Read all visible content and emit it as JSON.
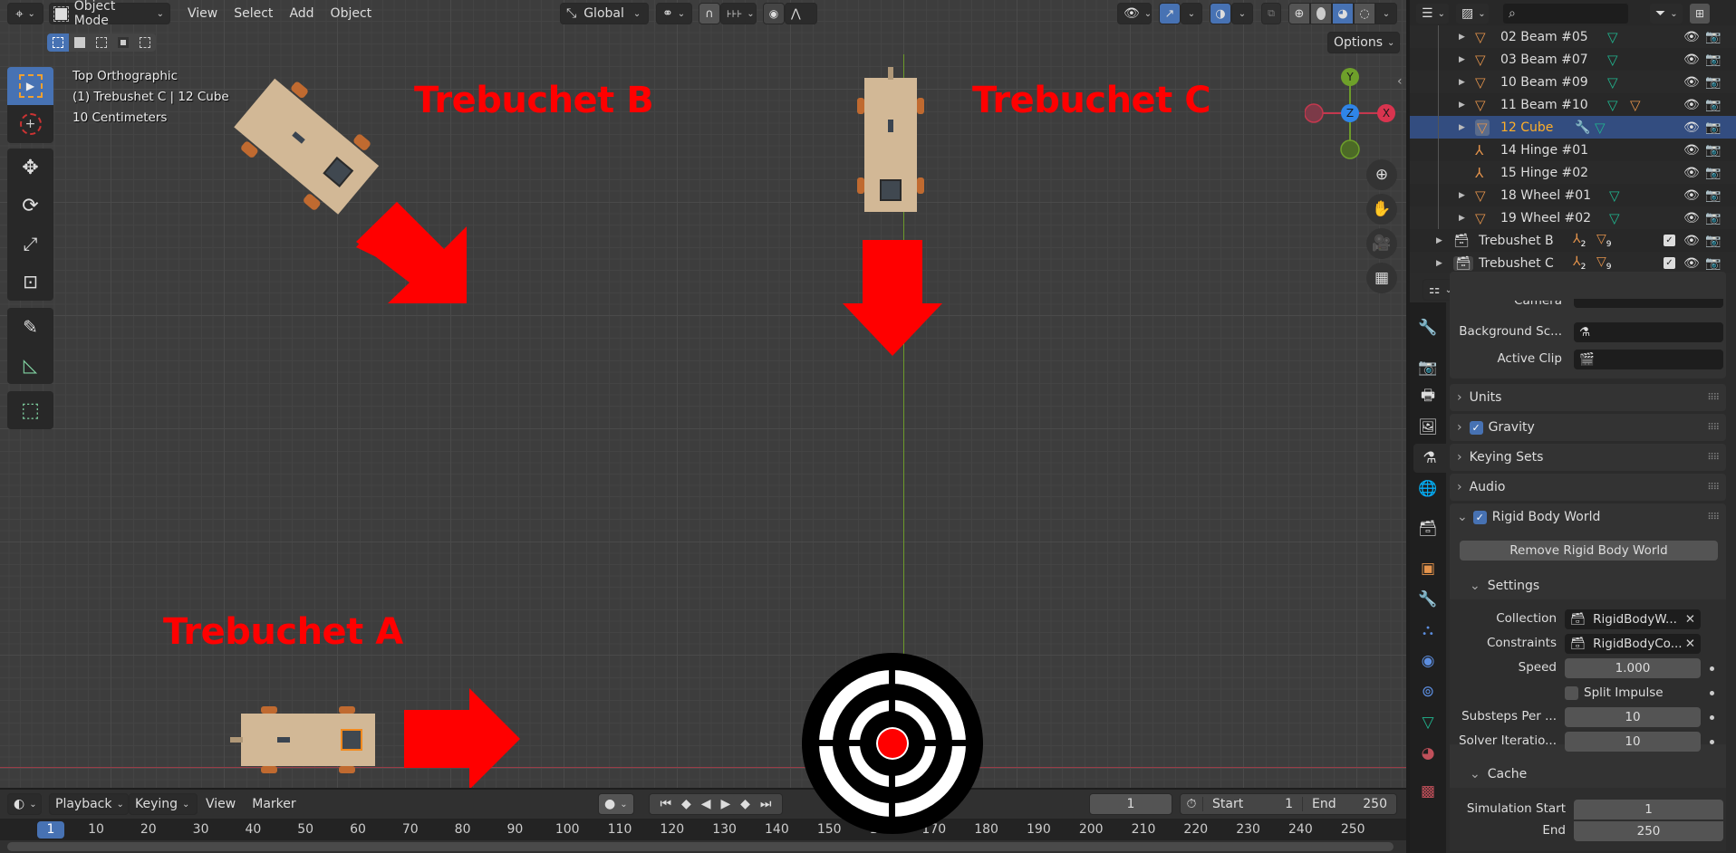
{
  "viewport_header": {
    "editor_type_icon": "3d-viewport-icon",
    "mode": "Object Mode",
    "menus": [
      "View",
      "Select",
      "Add",
      "Object"
    ],
    "transform_orientation": "Global",
    "options_label": "Options"
  },
  "viewport_overlay": {
    "view_name": "Top Orthographic",
    "context": "(1) Trebushet C | 12 Cube",
    "scale": "10 Centimeters"
  },
  "scene_labels": {
    "trebuchet_a": "Trebuchet A",
    "trebuchet_b": "Trebuchet B",
    "trebuchet_c": "Trebuchet C"
  },
  "gizmo": {
    "x": "X",
    "y": "Y",
    "z": "Z"
  },
  "toolbar": {
    "tools": [
      "select-box",
      "cursor",
      "move",
      "rotate",
      "scale",
      "transform",
      "annotate",
      "measure",
      "add-cube"
    ],
    "active": "select-box"
  },
  "outliner": {
    "rows": [
      {
        "name": "02 Beam #05",
        "type": "mesh",
        "selected": false
      },
      {
        "name": "03 Beam #07",
        "type": "mesh",
        "selected": false
      },
      {
        "name": "10 Beam #09",
        "type": "mesh",
        "selected": false
      },
      {
        "name": "11 Beam #10",
        "type": "mesh",
        "selected": false
      },
      {
        "name": "12 Cube",
        "type": "mesh",
        "selected": true
      },
      {
        "name": "14 Hinge #01",
        "type": "empty",
        "selected": false
      },
      {
        "name": "15 Hinge #02",
        "type": "empty",
        "selected": false
      },
      {
        "name": "18 Wheel #01",
        "type": "mesh",
        "selected": false
      },
      {
        "name": "19 Wheel #02",
        "type": "mesh",
        "selected": false
      }
    ],
    "collections": [
      {
        "name": "Trebushet B",
        "empties": "2",
        "meshes": "9"
      },
      {
        "name": "Trebushet C",
        "empties": "2",
        "meshes": "9"
      }
    ]
  },
  "properties": {
    "camera_label": "Camera",
    "background_label": "Background Sc...",
    "active_clip_label": "Active Clip",
    "panels": {
      "units": "Units",
      "gravity": "Gravity",
      "keying_sets": "Keying Sets",
      "audio": "Audio",
      "rigid_body_world": "Rigid Body World"
    },
    "gravity_enabled": true,
    "rigid_body_enabled": true,
    "remove_button": "Remove Rigid Body World",
    "settings": {
      "title": "Settings",
      "collection_label": "Collection",
      "collection_value": "RigidBodyW...",
      "constraints_label": "Constraints",
      "constraints_value": "RigidBodyCo...",
      "speed_label": "Speed",
      "speed_value": "1.000",
      "split_impulse_label": "Split Impulse",
      "split_impulse": false,
      "substeps_label": "Substeps Per ...",
      "substeps_value": "10",
      "solver_label": "Solver Iteratio...",
      "solver_value": "10"
    },
    "cache": {
      "title": "Cache",
      "sim_start_label": "Simulation Start",
      "sim_start_value": "1",
      "end_label": "End",
      "end_value": "250"
    }
  },
  "timeline": {
    "menus": [
      "Playback",
      "Keying",
      "View",
      "Marker"
    ],
    "current_frame": "1",
    "start_label": "Start",
    "start_value": "1",
    "end_label": "End",
    "end_value": "250",
    "ticks": [
      "10",
      "20",
      "30",
      "40",
      "50",
      "60",
      "70",
      "80",
      "90",
      "100",
      "110",
      "120",
      "130",
      "140",
      "150",
      "160",
      "170",
      "180",
      "190",
      "200",
      "210",
      "220",
      "230",
      "240",
      "250"
    ],
    "playhead": "1"
  },
  "colors": {
    "accent": "#4772b3",
    "selected_text": "#ffaf29",
    "mesh_icon": "#e4934b",
    "data_icon": "#20b58f",
    "arrow_red": "#ff0000"
  }
}
